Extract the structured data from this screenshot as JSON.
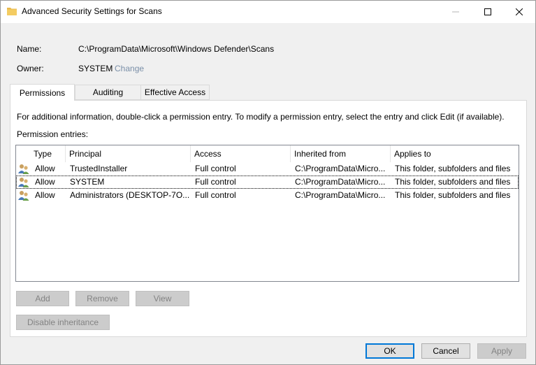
{
  "window": {
    "title": "Advanced Security Settings for Scans"
  },
  "details": {
    "name_label": "Name:",
    "name_value": "C:\\ProgramData\\Microsoft\\Windows Defender\\Scans",
    "owner_label": "Owner:",
    "owner_value": "SYSTEM",
    "owner_change": "Change"
  },
  "tabs": [
    {
      "label": "Permissions",
      "active": true
    },
    {
      "label": "Auditing",
      "active": false
    },
    {
      "label": "Effective Access",
      "active": false
    }
  ],
  "info_text": "For additional information, double-click a permission entry. To modify a permission entry, select the entry and click Edit (if available).",
  "entries_label": "Permission entries:",
  "table": {
    "columns": [
      "Type",
      "Principal",
      "Access",
      "Inherited from",
      "Applies to"
    ],
    "rows": [
      {
        "type": "Allow",
        "principal": "TrustedInstaller",
        "access": "Full control",
        "inherited": "C:\\ProgramData\\Micro...",
        "applies": "This folder, subfolders and files"
      },
      {
        "type": "Allow",
        "principal": "SYSTEM",
        "access": "Full control",
        "inherited": "C:\\ProgramData\\Micro...",
        "applies": "This folder, subfolders and files"
      },
      {
        "type": "Allow",
        "principal": "Administrators (DESKTOP-7O...",
        "access": "Full control",
        "inherited": "C:\\ProgramData\\Micro...",
        "applies": "This folder, subfolders and files"
      }
    ]
  },
  "buttons": {
    "add": "Add",
    "remove": "Remove",
    "view": "View",
    "disable_inheritance": "Disable inheritance",
    "ok": "OK",
    "cancel": "Cancel",
    "apply": "Apply"
  },
  "colors": {
    "accent": "#0078d7",
    "link_disabled": "#7a8fa8"
  }
}
